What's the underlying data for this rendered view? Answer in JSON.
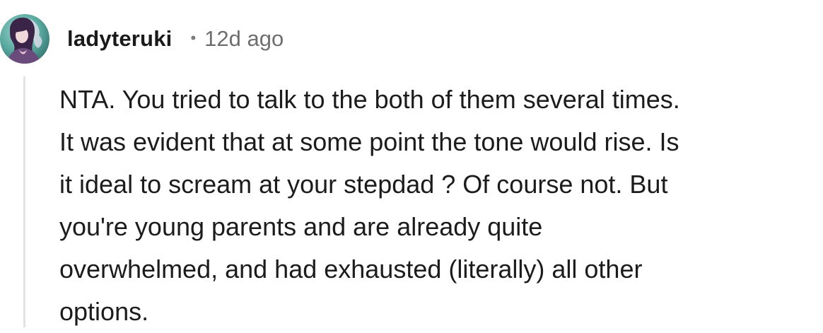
{
  "comment": {
    "author": {
      "username": "ladyteruki",
      "avatar_icon": "user-avatar-icon"
    },
    "separator": "•",
    "timestamp": "12d ago",
    "body_lines": [
      "NTA. You tried to talk to the both of them several times.",
      "It was evident that at some point the tone would rise. Is",
      "it ideal to scream at your stepdad ? Of course not. But",
      "you're young parents and are already quite",
      "overwhelmed, and had exhausted (literally) all other",
      "options."
    ]
  },
  "colors": {
    "username": "#1a1a1b",
    "timestamp": "#6e6e6e",
    "body_text": "#1c1c1c",
    "thread_line": "#e3e3e3",
    "background": "#ffffff"
  }
}
